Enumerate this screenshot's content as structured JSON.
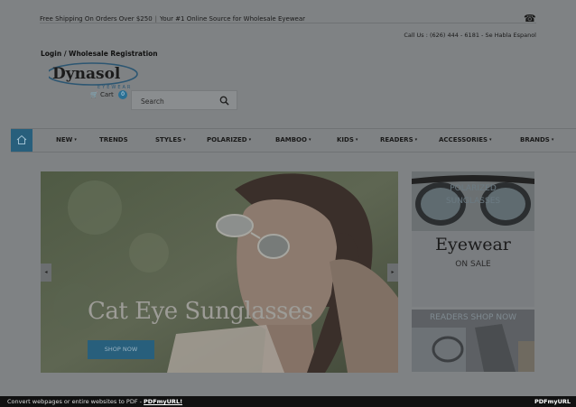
{
  "topbar": {
    "shipping": "Free Shipping On Orders Over $250",
    "tagline": "Your #1 Online Source for Wholesale Eyewear",
    "call": "Call Us : (626) 444 - 6181 - Se Habla Espanol",
    "phone_icon": "phone-icon"
  },
  "header": {
    "login": "Login / Wholesale Registration",
    "logo_text": "Dynasol",
    "logo_sub": "EYEWEAR",
    "cart_label": "Cart",
    "cart_count": "0",
    "search_placeholder": "Search"
  },
  "nav": {
    "items": [
      {
        "label": "NEW",
        "has_dropdown": true
      },
      {
        "label": "TRENDS",
        "has_dropdown": false
      },
      {
        "label": "STYLES",
        "has_dropdown": true
      },
      {
        "label": "POLARIZED",
        "has_dropdown": true
      },
      {
        "label": "BAMBOO",
        "has_dropdown": true
      },
      {
        "label": "KIDS",
        "has_dropdown": true
      },
      {
        "label": "READERS",
        "has_dropdown": true
      },
      {
        "label": "ACCESSORIES",
        "has_dropdown": true
      },
      {
        "label": "BRANDS",
        "has_dropdown": true
      }
    ],
    "caret": "▾"
  },
  "hero": {
    "title": "Cat Eye Sunglasses",
    "button": "SHOP NOW",
    "prev": "◂",
    "next": "▸"
  },
  "promo_polarized": {
    "line1": "POLARIZED",
    "line2": "SUNGLASSES",
    "title": "Eyewear",
    "subtitle": "ON SALE"
  },
  "promo_readers": {
    "title": "READERS SHOP NOW"
  },
  "footer": {
    "text": "Convert webpages or entire websites to PDF - ",
    "link": "PDFmyURL!",
    "brand": "PDFmyURL"
  },
  "colors": {
    "accent": "#285f7c",
    "overlay_bg": "#7f8284"
  }
}
